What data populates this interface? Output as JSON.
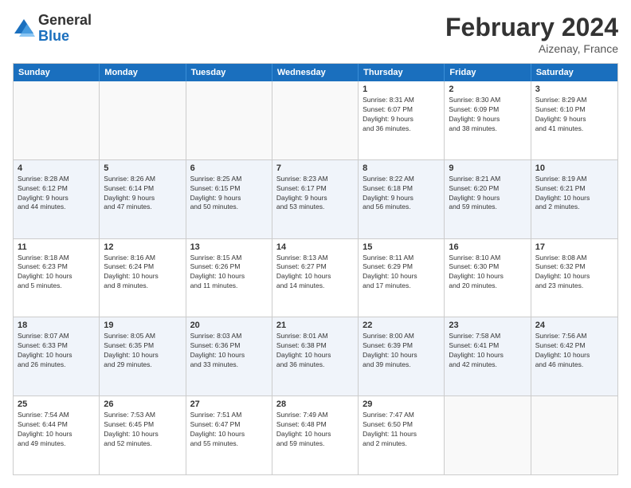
{
  "logo": {
    "line1": "General",
    "line2": "Blue"
  },
  "title": "February 2024",
  "subtitle": "Aizenay, France",
  "header_days": [
    "Sunday",
    "Monday",
    "Tuesday",
    "Wednesday",
    "Thursday",
    "Friday",
    "Saturday"
  ],
  "rows": [
    {
      "alt": false,
      "cells": [
        {
          "day": "",
          "info": ""
        },
        {
          "day": "",
          "info": ""
        },
        {
          "day": "",
          "info": ""
        },
        {
          "day": "",
          "info": ""
        },
        {
          "day": "1",
          "info": "Sunrise: 8:31 AM\nSunset: 6:07 PM\nDaylight: 9 hours\nand 36 minutes."
        },
        {
          "day": "2",
          "info": "Sunrise: 8:30 AM\nSunset: 6:09 PM\nDaylight: 9 hours\nand 38 minutes."
        },
        {
          "day": "3",
          "info": "Sunrise: 8:29 AM\nSunset: 6:10 PM\nDaylight: 9 hours\nand 41 minutes."
        }
      ]
    },
    {
      "alt": true,
      "cells": [
        {
          "day": "4",
          "info": "Sunrise: 8:28 AM\nSunset: 6:12 PM\nDaylight: 9 hours\nand 44 minutes."
        },
        {
          "day": "5",
          "info": "Sunrise: 8:26 AM\nSunset: 6:14 PM\nDaylight: 9 hours\nand 47 minutes."
        },
        {
          "day": "6",
          "info": "Sunrise: 8:25 AM\nSunset: 6:15 PM\nDaylight: 9 hours\nand 50 minutes."
        },
        {
          "day": "7",
          "info": "Sunrise: 8:23 AM\nSunset: 6:17 PM\nDaylight: 9 hours\nand 53 minutes."
        },
        {
          "day": "8",
          "info": "Sunrise: 8:22 AM\nSunset: 6:18 PM\nDaylight: 9 hours\nand 56 minutes."
        },
        {
          "day": "9",
          "info": "Sunrise: 8:21 AM\nSunset: 6:20 PM\nDaylight: 9 hours\nand 59 minutes."
        },
        {
          "day": "10",
          "info": "Sunrise: 8:19 AM\nSunset: 6:21 PM\nDaylight: 10 hours\nand 2 minutes."
        }
      ]
    },
    {
      "alt": false,
      "cells": [
        {
          "day": "11",
          "info": "Sunrise: 8:18 AM\nSunset: 6:23 PM\nDaylight: 10 hours\nand 5 minutes."
        },
        {
          "day": "12",
          "info": "Sunrise: 8:16 AM\nSunset: 6:24 PM\nDaylight: 10 hours\nand 8 minutes."
        },
        {
          "day": "13",
          "info": "Sunrise: 8:15 AM\nSunset: 6:26 PM\nDaylight: 10 hours\nand 11 minutes."
        },
        {
          "day": "14",
          "info": "Sunrise: 8:13 AM\nSunset: 6:27 PM\nDaylight: 10 hours\nand 14 minutes."
        },
        {
          "day": "15",
          "info": "Sunrise: 8:11 AM\nSunset: 6:29 PM\nDaylight: 10 hours\nand 17 minutes."
        },
        {
          "day": "16",
          "info": "Sunrise: 8:10 AM\nSunset: 6:30 PM\nDaylight: 10 hours\nand 20 minutes."
        },
        {
          "day": "17",
          "info": "Sunrise: 8:08 AM\nSunset: 6:32 PM\nDaylight: 10 hours\nand 23 minutes."
        }
      ]
    },
    {
      "alt": true,
      "cells": [
        {
          "day": "18",
          "info": "Sunrise: 8:07 AM\nSunset: 6:33 PM\nDaylight: 10 hours\nand 26 minutes."
        },
        {
          "day": "19",
          "info": "Sunrise: 8:05 AM\nSunset: 6:35 PM\nDaylight: 10 hours\nand 29 minutes."
        },
        {
          "day": "20",
          "info": "Sunrise: 8:03 AM\nSunset: 6:36 PM\nDaylight: 10 hours\nand 33 minutes."
        },
        {
          "day": "21",
          "info": "Sunrise: 8:01 AM\nSunset: 6:38 PM\nDaylight: 10 hours\nand 36 minutes."
        },
        {
          "day": "22",
          "info": "Sunrise: 8:00 AM\nSunset: 6:39 PM\nDaylight: 10 hours\nand 39 minutes."
        },
        {
          "day": "23",
          "info": "Sunrise: 7:58 AM\nSunset: 6:41 PM\nDaylight: 10 hours\nand 42 minutes."
        },
        {
          "day": "24",
          "info": "Sunrise: 7:56 AM\nSunset: 6:42 PM\nDaylight: 10 hours\nand 46 minutes."
        }
      ]
    },
    {
      "alt": false,
      "cells": [
        {
          "day": "25",
          "info": "Sunrise: 7:54 AM\nSunset: 6:44 PM\nDaylight: 10 hours\nand 49 minutes."
        },
        {
          "day": "26",
          "info": "Sunrise: 7:53 AM\nSunset: 6:45 PM\nDaylight: 10 hours\nand 52 minutes."
        },
        {
          "day": "27",
          "info": "Sunrise: 7:51 AM\nSunset: 6:47 PM\nDaylight: 10 hours\nand 55 minutes."
        },
        {
          "day": "28",
          "info": "Sunrise: 7:49 AM\nSunset: 6:48 PM\nDaylight: 10 hours\nand 59 minutes."
        },
        {
          "day": "29",
          "info": "Sunrise: 7:47 AM\nSunset: 6:50 PM\nDaylight: 11 hours\nand 2 minutes."
        },
        {
          "day": "",
          "info": ""
        },
        {
          "day": "",
          "info": ""
        }
      ]
    }
  ]
}
